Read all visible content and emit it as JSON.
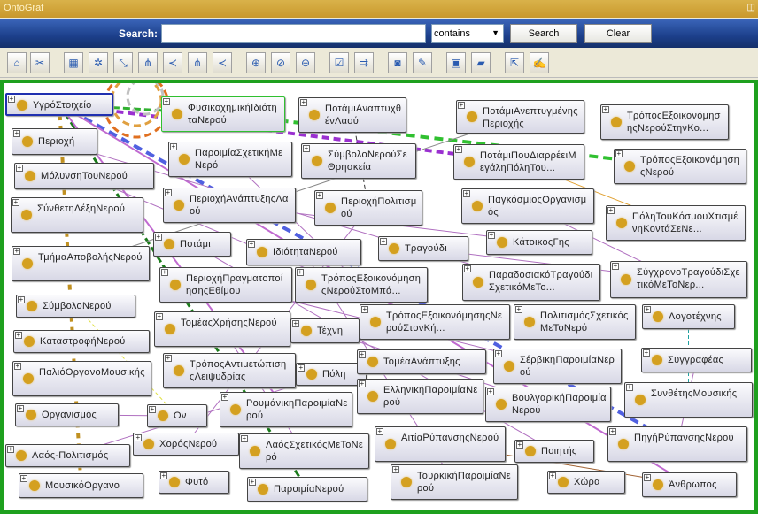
{
  "window": {
    "title": "OntoGraf",
    "controls_glyph": "◫"
  },
  "search": {
    "label": "Search:",
    "value": "",
    "mode": "contains",
    "search_button": "Search",
    "clear_button": "Clear"
  },
  "toolbar": {
    "icons": [
      "home-icon",
      "remove-icon",
      "grid-layout-icon",
      "spring-layout-icon",
      "path-layout-icon",
      "tree-layout-icon",
      "horizontal-tree-icon",
      "tree-layout-2-icon",
      "horizontal-tree-2-icon",
      "zoom-in-icon",
      "zoom-fit-icon",
      "zoom-out-icon",
      "filter-nodes-icon",
      "filter-arcs-icon",
      "camera-icon",
      "edit-image-icon",
      "save-icon",
      "open-folder-icon",
      "export-icon",
      "edit-icon"
    ]
  },
  "colors": {
    "accent_border": "#1ea01e",
    "node_dot": "#d4a020",
    "selected_border": "#2030b0"
  },
  "graph": {
    "selected": "ΥγρόΣτοιχείο",
    "nodes": [
      "ΥγρόΣτοιχείο",
      "ΦυσικοχημικήΙδιότηταΝερού",
      "ΠοτάμιΑναπτυχθένΛαού",
      "ΠοτάμιΑνεπτυγμένηςΠεριοχής",
      "ΤρόποςΕξοικονόμησηςΝερούΣτηνΚο...",
      "Περιοχή",
      "ΠαροιμίαΣχετικήΜεΝερό",
      "ΣύμβολοΝερούΣεΘρησκεία",
      "ΠοτάμιΠουΔιαρρέειΜεγάληΠόληΤου...",
      "ΤρόποςΕξοικονόμησηςΝερού",
      "ΜόλυνσηΤουΝερού",
      "ΠεριοχήΑνάπτυξηςΛαού",
      "ΠεριοχήΠολιτισμού",
      "ΠαγκόσμιοςΟργανισμός",
      "ΠόληΤουΚόσμουΧτισμένηΚοντάΣεΝε...",
      "ΣύνθετηΛέξηΝερού",
      "Ποτάμι",
      "ΙδιότηταΝερού",
      "Τραγούδι",
      "ΚάτοικοςΓης",
      "ΤμήμαΑποβολήςΝερού",
      "ΠεριοχήΠραγματοποίησηςΕθίμου",
      "ΤρόποςΕξοικονόμησηςΝερούΣτοΜπά...",
      "ΠαραδοσιακόΤραγούδιΣχετικόΜεΤο...",
      "ΣύγχρονοΤραγούδιΣχετικόΜεΤοΝερ...",
      "ΣύμβολοΝερού",
      "ΤομέαςΧρήσηςΝερού",
      "Τέχνη",
      "ΤρόποςΕξοικονόμησηςΝερούΣτονΚή...",
      "ΠολιτισμόςΣχετικόςΜεΤοΝερό",
      "Λογοτέχνης",
      "ΚαταστροφήΝερού",
      "ΤρόποςΑντιμετώπισηςΛειψυδρίας",
      "Πόλη",
      "ΤομέαΑνάπτυξης",
      "ΣέρβικηΠαροιμίαΝερού",
      "Συγγραφέας",
      "ΠαλιόΟργανοΜουσικής",
      "ΕλληνικήΠαροιμίαΝερού",
      "ΒουλγαρικήΠαροιμίαΝερού",
      "ΣυνθέτηςΜουσικής",
      "Οργανισμός",
      "Ον",
      "ΡουμάνικηΠαροιμίαΝερού",
      "ΑιτίαΡύπανσηςΝερού",
      "ΠηγήΡύπανσηςΝερού",
      "ΧορόςΝερού",
      "ΛαόςΣχετικόςΜεΤοΝερό",
      "Λαός-Πολιτισμός",
      "Ποιητής",
      "ΜουσικόΟργανο",
      "Φυτό",
      "ΠαροιμίαΝερού",
      "ΤουρκικήΠαροιμίαΝερού",
      "Χώρα",
      "Άνθρωπος"
    ]
  }
}
